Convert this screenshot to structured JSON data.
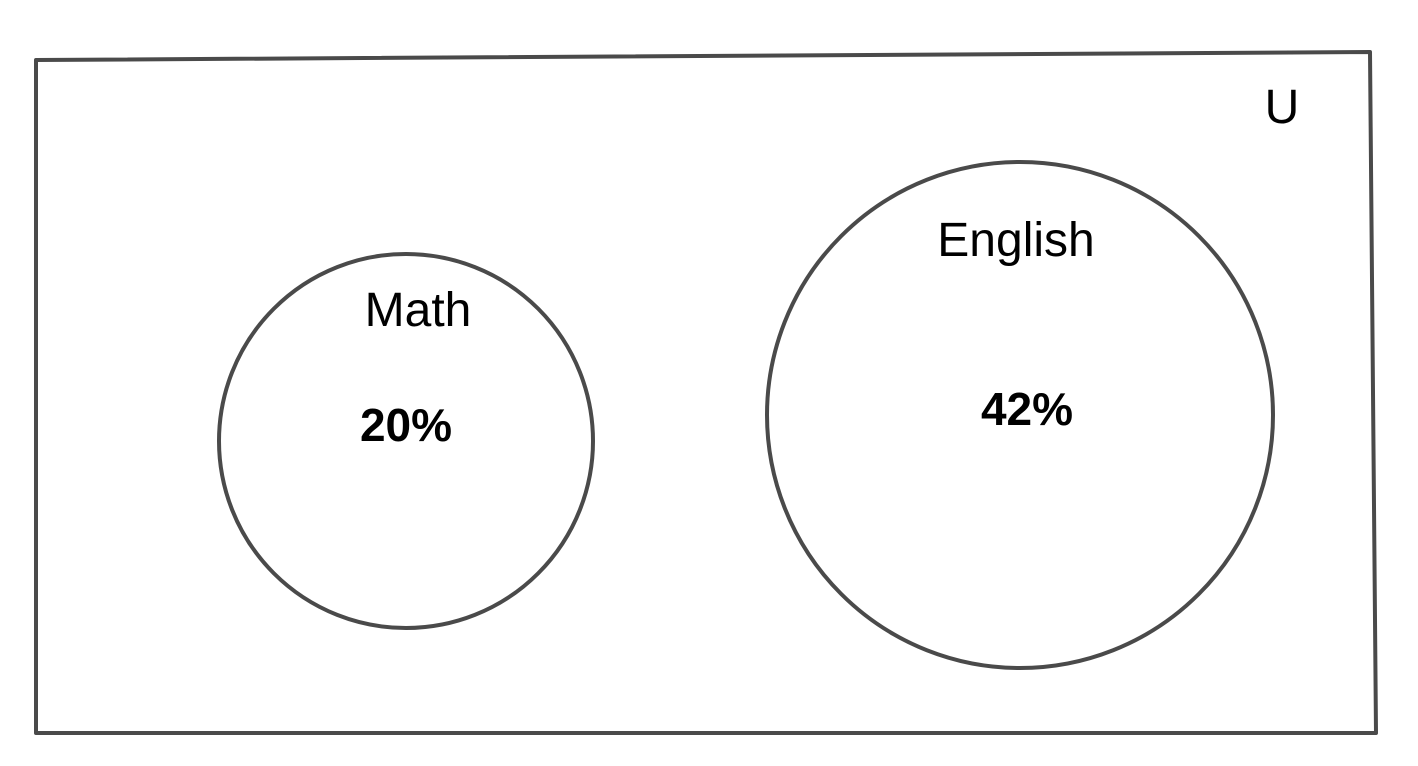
{
  "diagram": {
    "type": "venn",
    "universe_label": "U",
    "sets": [
      {
        "label": "Math",
        "value": "20%"
      },
      {
        "label": "English",
        "value": "42%"
      }
    ],
    "line_color": "#4a4a4a",
    "text_color": "#000000",
    "background_color": "#ffffff"
  }
}
